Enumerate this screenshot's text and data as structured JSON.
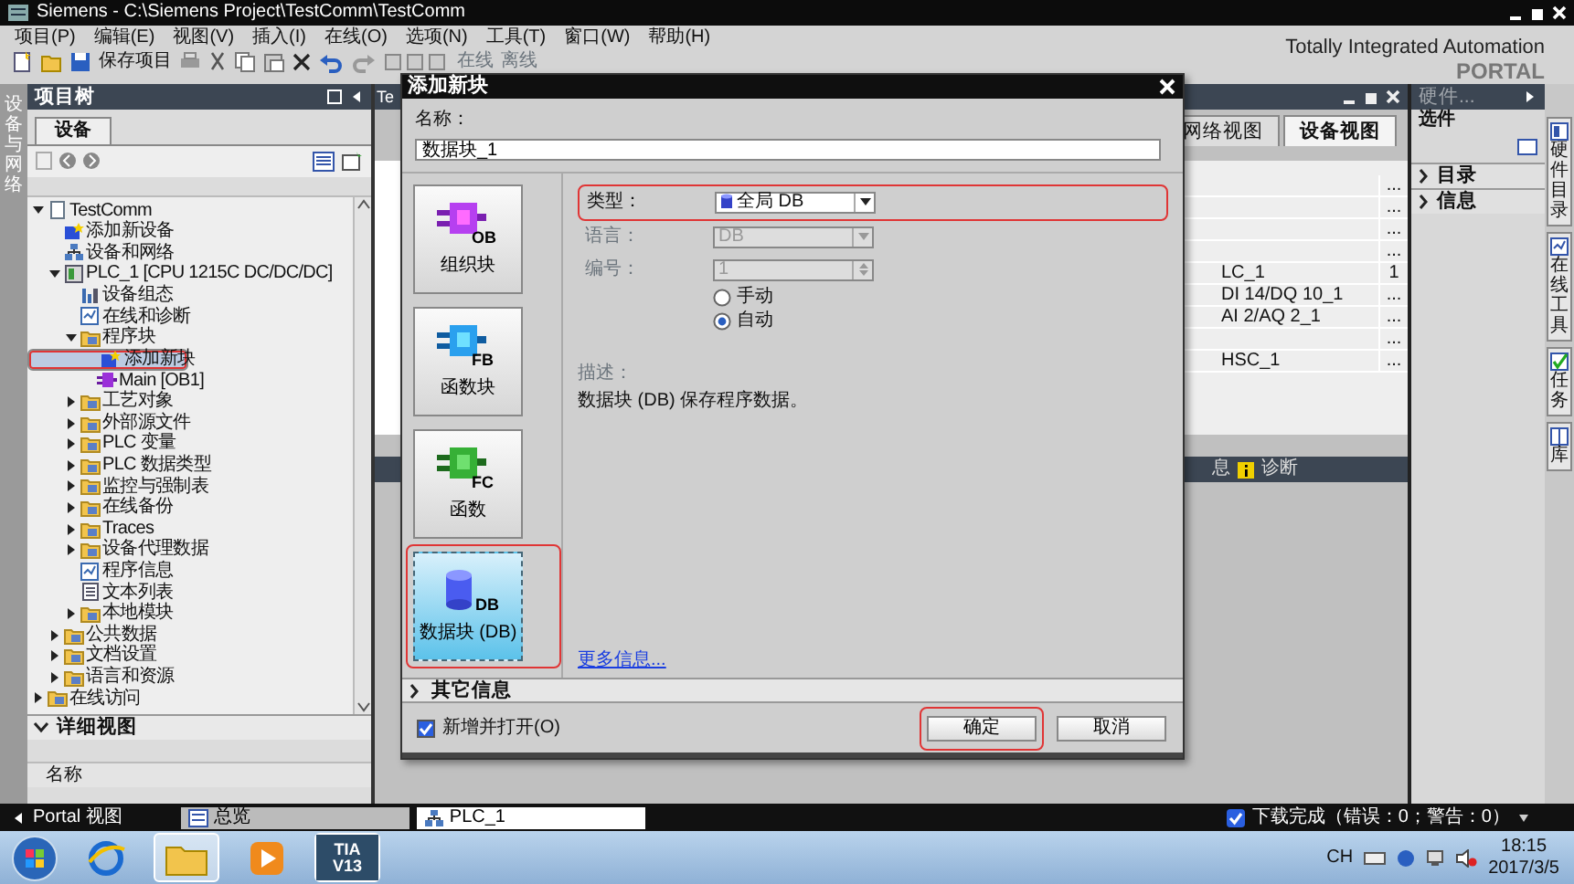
{
  "window": {
    "title": "Siemens - C:\\Siemens Project\\TestComm\\TestComm"
  },
  "menu": [
    "项目(P)",
    "编辑(E)",
    "视图(V)",
    "插入(I)",
    "在线(O)",
    "选项(N)",
    "工具(T)",
    "窗口(W)",
    "帮助(H)"
  ],
  "toolbar": {
    "save_label": "保存项目",
    "online_label": "在线",
    "offline_label": "离线"
  },
  "brand": {
    "line_1": "Totally Integrated Automation",
    "line_2": "PORTAL"
  },
  "left_strip": {
    "label": "设备与网络"
  },
  "project_tree": {
    "title": "项目树",
    "tab": "设备",
    "items": [
      {
        "label": "TestComm",
        "kind": "project",
        "expanded": true,
        "selected": false,
        "highlighted": false,
        "children": [
          {
            "label": "添加新设备",
            "kind": "add",
            "selected": false,
            "highlighted": false
          },
          {
            "label": "设备和网络",
            "kind": "network",
            "selected": false,
            "highlighted": false
          },
          {
            "label": "PLC_1 [CPU 1215C DC/DC/DC]",
            "kind": "device",
            "expanded": true,
            "selected": false,
            "highlighted": false,
            "children": [
              {
                "label": "设备组态",
                "kind": "config",
                "selected": false,
                "highlighted": false
              },
              {
                "label": "在线和诊断",
                "kind": "diagnostics",
                "selected": false,
                "highlighted": false
              },
              {
                "label": "程序块",
                "kind": "folder",
                "expanded": true,
                "selected": false,
                "highlighted": false,
                "children": [
                  {
                    "label": "添加新块",
                    "kind": "add",
                    "selected": true,
                    "highlighted": true
                  },
                  {
                    "label": "Main [OB1]",
                    "kind": "block",
                    "selected": false,
                    "highlighted": false
                  }
                ]
              },
              {
                "label": "工艺对象",
                "kind": "folder",
                "expanded": false,
                "selected": false,
                "highlighted": false
              },
              {
                "label": "外部源文件",
                "kind": "folder",
                "expanded": false,
                "selected": false,
                "highlighted": false
              },
              {
                "label": "PLC 变量",
                "kind": "folder",
                "expanded": false,
                "selected": false,
                "highlighted": false
              },
              {
                "label": "PLC 数据类型",
                "kind": "folder",
                "expanded": false,
                "selected": false,
                "highlighted": false
              },
              {
                "label": "监控与强制表",
                "kind": "folder",
                "expanded": false,
                "selected": false,
                "highlighted": false
              },
              {
                "label": "在线备份",
                "kind": "folder",
                "expanded": false,
                "selected": false,
                "highlighted": false
              },
              {
                "label": "Traces",
                "kind": "folder",
                "expanded": false,
                "selected": false,
                "highlighted": false
              },
              {
                "label": "设备代理数据",
                "kind": "folder",
                "expanded": false,
                "selected": false,
                "highlighted": false
              },
              {
                "label": "程序信息",
                "kind": "diagnostics",
                "selected": false,
                "highlighted": false
              },
              {
                "label": "文本列表",
                "kind": "document",
                "selected": false,
                "highlighted": false
              },
              {
                "label": "本地模块",
                "kind": "folder",
                "expanded": false,
                "selected": false,
                "highlighted": false
              }
            ]
          },
          {
            "label": "公共数据",
            "kind": "folder",
            "expanded": false,
            "selected": false,
            "highlighted": false
          },
          {
            "label": "文档设置",
            "kind": "folder",
            "expanded": false,
            "selected": false,
            "highlighted": false
          },
          {
            "label": "语言和资源",
            "kind": "folder",
            "expanded": false,
            "selected": false,
            "highlighted": false
          }
        ]
      },
      {
        "label": "在线访问",
        "kind": "folder",
        "expanded": false,
        "selected": false,
        "highlighted": false
      }
    ],
    "detail_view": {
      "title": "详细视图",
      "expanded": true,
      "column": "名称"
    }
  },
  "editor": {
    "tab": "Te",
    "view_tabs": [
      {
        "label": "网络视图",
        "selected": false
      },
      {
        "label": "设备视图",
        "selected": true
      }
    ],
    "table": {
      "rows": [
        {
          "column_2": "..."
        },
        {
          "column_2": "..."
        },
        {
          "column_2": "..."
        },
        {
          "column_2": "..."
        },
        {
          "column_1": "LC_1",
          "column_2": "1"
        },
        {
          "column_1": "DI 14/DQ 10_1",
          "column_2": "..."
        },
        {
          "column_1": "AI 2/AQ 2_1",
          "column_2": "..."
        },
        {
          "column_2": "..."
        },
        {
          "column_1": "HSC_1",
          "column_2": "..."
        }
      ]
    },
    "inspector_tabs": [
      {
        "label": "息",
        "kind": "info"
      },
      {
        "label": "诊断",
        "kind": "diagnostics"
      }
    ]
  },
  "task_card": {
    "title": "硬件...",
    "section": "选件",
    "panes": [
      {
        "label": "目录",
        "expanded": false
      },
      {
        "label": "信息",
        "expanded": false
      }
    ]
  },
  "side_tabs": [
    {
      "label": "硬件目录"
    },
    {
      "label": "在线工具"
    },
    {
      "label": "任务"
    },
    {
      "label": "库"
    }
  ],
  "dialog": {
    "title": "添加新块",
    "name_label": "名称：",
    "name_value": "数据块_1",
    "blocks": [
      {
        "kind": "ob",
        "code": "OB",
        "label": "组织块",
        "selected": false,
        "highlighted": false
      },
      {
        "kind": "fb",
        "code": "FB",
        "label": "函数块",
        "selected": false,
        "highlighted": false
      },
      {
        "kind": "fc",
        "code": "FC",
        "label": "函数",
        "selected": false,
        "highlighted": false
      },
      {
        "kind": "db",
        "code": "DB",
        "label": "数据块 (DB)",
        "selected": true,
        "highlighted": true
      }
    ],
    "fields": [
      {
        "kind": "type",
        "label": "类型：",
        "value": "全局 DB",
        "disabled": false,
        "highlighted": true
      },
      {
        "kind": "select",
        "label": "语言：",
        "value": "DB",
        "disabled": true
      },
      {
        "kind": "spinner",
        "label": "编号：",
        "value": "1",
        "disabled": true
      }
    ],
    "numbering": [
      {
        "label": "手动",
        "selected": false
      },
      {
        "label": "自动",
        "selected": true
      }
    ],
    "description_label": "描述：",
    "description": "数据块 (DB) 保存程序数据。",
    "more_info": "更多信息...",
    "more_section": {
      "label": "其它信息",
      "expanded": false
    },
    "open_checkbox": {
      "label": "新增并打开(O)",
      "checked": true
    },
    "buttons": [
      {
        "label": "确定",
        "highlighted": true
      },
      {
        "label": "取消",
        "highlighted": false
      }
    ]
  },
  "status_bar": {
    "portal": "Portal 视图",
    "tabs": [
      {
        "label": "总览",
        "selected": false
      },
      {
        "label": "PLC_1",
        "selected": true
      }
    ],
    "message": "下载完成（错误：0；警告：0）",
    "message_ok": true
  },
  "taskbar": {
    "tia_line_1": "TIA",
    "tia_line_2": "V13",
    "language": "CH",
    "time": "18:15",
    "date": "2017/3/5"
  }
}
